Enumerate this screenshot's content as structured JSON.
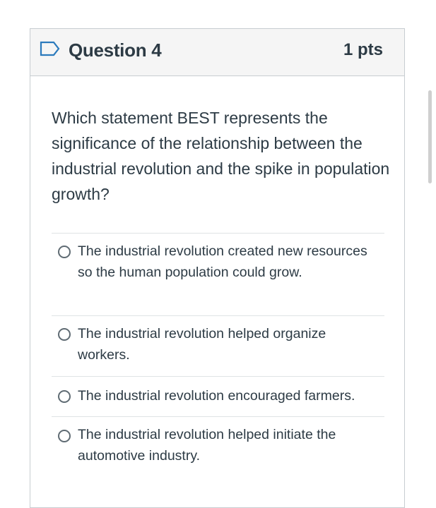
{
  "question": {
    "title": "Question 4",
    "points": "1 pts",
    "text": "Which statement BEST represents the significance of the relationship between the industrial revolution and the spike in population growth?",
    "flag_icon": "flag-outline-icon"
  },
  "answers": [
    {
      "label": "The industrial revolution created new resources so the human population could grow.",
      "selected": false
    },
    {
      "label": "The industrial revolution helped organize workers.",
      "selected": false
    },
    {
      "label": "The industrial revolution encouraged farmers.",
      "selected": false
    },
    {
      "label": "The industrial revolution helped initiate the automotive industry.",
      "selected": false
    }
  ],
  "colors": {
    "header_bg": "#f5f5f5",
    "border": "#c7cdd1",
    "flag": "#2b7abc",
    "text": "#2d3b45"
  }
}
